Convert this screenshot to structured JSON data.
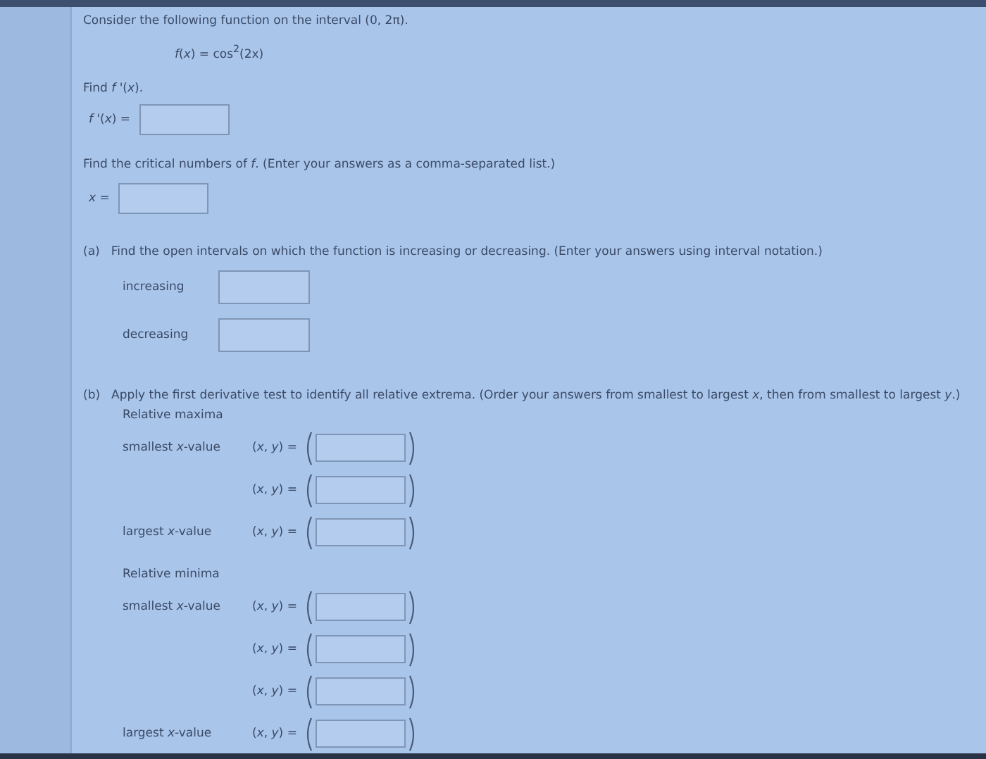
{
  "intro": "Consider the following function on the interval (0, 2π).",
  "formula": "*f*(*x*) = cos$^{2}$(2x)",
  "derivative": {
    "prompt": "Find *f* '(*x*).",
    "label": "*f* '(*x*) ="
  },
  "critical": {
    "prompt": "Find the critical numbers of *f*. (Enter your answers as a comma-separated list.)",
    "label": "*x* ="
  },
  "part_a": {
    "marker": "(a)",
    "prompt": "Find the open intervals on which the function is increasing or decreasing. (Enter your answers using interval notation.)",
    "rows": [
      {
        "label": "increasing"
      },
      {
        "label": "decreasing"
      }
    ]
  },
  "part_b": {
    "marker": "(b)",
    "prompt": "Apply the first derivative test to identify all relative extrema. (Order your answers from smallest to largest *x*, then from smallest to largest *y*.)",
    "groups": [
      {
        "title": "Relative maxima",
        "rows": [
          {
            "label": "smallest *x*-value",
            "pair": "(*x*, *y*) ="
          },
          {
            "pair": "(*x*, *y*) ="
          },
          {
            "label": "largest *x*-value",
            "pair": "(*x*, *y*) ="
          }
        ]
      },
      {
        "title": "Relative minima",
        "rows": [
          {
            "label": "smallest *x*-value",
            "pair": "(*x*, *y*) ="
          },
          {
            "pair": "(*x*, *y*) ="
          },
          {
            "pair": "(*x*, *y*) ="
          },
          {
            "label": "largest *x*-value",
            "pair": "(*x*, *y*) ="
          }
        ]
      }
    ]
  }
}
